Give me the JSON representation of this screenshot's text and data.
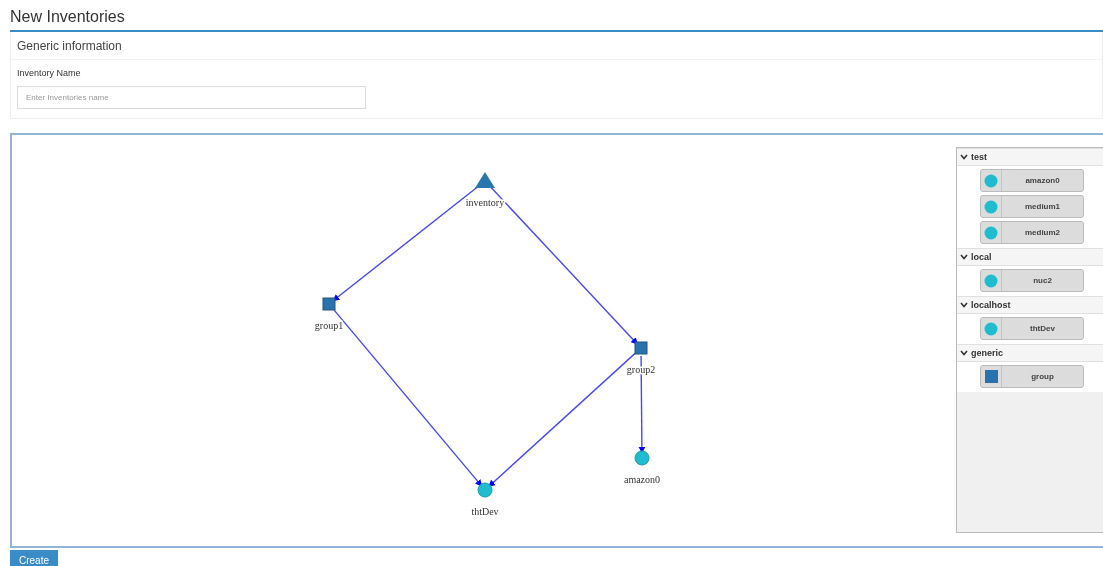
{
  "page": {
    "title": "New Inventories"
  },
  "generic_panel": {
    "heading": "Generic information",
    "field_label": "Inventory Name",
    "placeholder": "Enter Inventories name"
  },
  "graph": {
    "nodes": [
      {
        "label": "inventory",
        "kind": "triangle"
      },
      {
        "label": "group1",
        "kind": "square"
      },
      {
        "label": "group2",
        "kind": "square"
      },
      {
        "label": "thtDev",
        "kind": "circle"
      },
      {
        "label": "amazon0",
        "kind": "circle"
      }
    ]
  },
  "palette": [
    {
      "name": "test",
      "expanded": true,
      "items": [
        {
          "label": "amazon0",
          "kind": "circle"
        },
        {
          "label": "medium1",
          "kind": "circle"
        },
        {
          "label": "medium2",
          "kind": "circle"
        }
      ]
    },
    {
      "name": "local",
      "expanded": true,
      "items": [
        {
          "label": "nuc2",
          "kind": "circle"
        }
      ]
    },
    {
      "name": "localhost",
      "expanded": true,
      "items": [
        {
          "label": "thtDev",
          "kind": "circle"
        }
      ]
    },
    {
      "name": "generic",
      "expanded": true,
      "items": [
        {
          "label": "group",
          "kind": "square"
        }
      ]
    }
  ],
  "create_button": "Create"
}
